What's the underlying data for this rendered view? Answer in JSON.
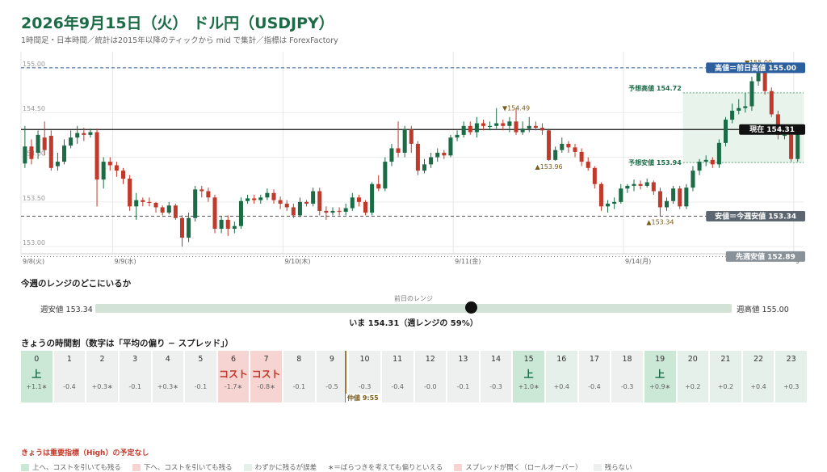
{
  "header": {
    "title": "2026年9月15日（火） ドル円（USDJPY）",
    "subtitle": "1時間足・日本時間／統計は2015年以降のティックから mid で集計／指標は ForexFactory"
  },
  "colors": {
    "up": "#1b6b46",
    "down": "#c0392b",
    "accent": "#1b6b46"
  },
  "chart_data": {
    "type": "candlestick",
    "ylim": [
      152.92,
      155.18
    ],
    "yticks": [
      "155.00",
      "154.50",
      "154.00",
      "153.50",
      "153.00"
    ],
    "ytick_values": [
      155.0,
      154.5,
      154.0,
      153.5,
      153.0
    ],
    "xticks": [
      {
        "label": "9/8(火)",
        "index": 0
      },
      {
        "label": "9/9(水)",
        "index": 14
      },
      {
        "label": "9/10(木)",
        "index": 40
      },
      {
        "label": "9/11(金)",
        "index": 66
      },
      {
        "label": "9/14(月)",
        "index": 92
      },
      {
        "label": "9",
        "index": 118
      }
    ],
    "candles": [
      [
        153.93,
        154.12,
        154.35,
        153.88
      ],
      [
        154.12,
        153.98,
        154.2,
        153.92
      ],
      [
        154.05,
        154.25,
        154.3,
        153.98
      ],
      [
        154.22,
        154.08,
        154.4,
        154.02
      ],
      [
        154.24,
        153.88,
        154.3,
        153.85
      ],
      [
        153.9,
        153.95,
        154.05,
        153.85
      ],
      [
        153.95,
        154.13,
        154.2,
        153.92
      ],
      [
        154.13,
        154.22,
        154.3,
        154.1
      ],
      [
        154.22,
        154.27,
        154.35,
        154.15
      ],
      [
        154.27,
        154.25,
        154.33,
        154.18
      ],
      [
        154.25,
        154.28,
        154.32,
        154.22
      ],
      [
        154.28,
        153.75,
        154.32,
        153.45
      ],
      [
        153.75,
        153.95,
        154.0,
        153.65
      ],
      [
        153.95,
        153.91,
        154.0,
        153.85
      ],
      [
        153.91,
        153.85,
        153.95,
        153.78
      ],
      [
        153.85,
        153.76,
        153.88,
        153.7
      ],
      [
        153.76,
        153.45,
        153.8,
        153.4
      ],
      [
        153.45,
        153.52,
        153.6,
        153.3
      ],
      [
        153.52,
        153.5,
        153.55,
        153.45
      ],
      [
        153.5,
        153.49,
        153.55,
        153.45
      ],
      [
        153.49,
        153.44,
        153.5,
        153.38
      ],
      [
        153.44,
        153.38,
        153.46,
        153.35
      ],
      [
        153.38,
        153.46,
        153.5,
        153.36
      ],
      [
        153.46,
        153.32,
        153.48,
        153.3
      ],
      [
        153.32,
        153.1,
        153.35,
        153.0
      ],
      [
        153.1,
        153.32,
        153.38,
        153.05
      ],
      [
        153.32,
        153.64,
        153.68,
        153.28
      ],
      [
        153.64,
        153.62,
        153.68,
        153.55
      ],
      [
        153.62,
        153.55,
        153.66,
        153.5
      ],
      [
        153.55,
        153.2,
        153.58,
        153.15
      ],
      [
        153.2,
        153.3,
        153.34,
        153.15
      ],
      [
        153.3,
        153.2,
        153.35,
        153.12
      ],
      [
        153.2,
        153.23,
        153.28,
        153.15
      ],
      [
        153.23,
        153.51,
        153.55,
        153.2
      ],
      [
        153.51,
        153.54,
        153.58,
        153.48
      ],
      [
        153.54,
        153.52,
        153.58,
        153.48
      ],
      [
        153.52,
        153.55,
        153.58,
        153.48
      ],
      [
        153.55,
        153.6,
        153.65,
        153.52
      ],
      [
        153.6,
        153.52,
        153.64,
        153.48
      ],
      [
        153.52,
        153.48,
        153.56,
        153.42
      ],
      [
        153.48,
        153.44,
        153.52,
        153.4
      ],
      [
        153.44,
        153.35,
        153.48,
        153.32
      ],
      [
        153.35,
        153.5,
        153.55,
        153.33
      ],
      [
        153.5,
        153.48,
        153.52,
        153.45
      ],
      [
        153.48,
        153.62,
        153.66,
        153.45
      ],
      [
        153.62,
        153.4,
        153.66,
        153.35
      ],
      [
        153.4,
        153.38,
        153.45,
        153.3
      ],
      [
        153.38,
        153.4,
        153.44,
        153.35
      ],
      [
        153.4,
        153.39,
        153.44,
        153.35
      ],
      [
        153.39,
        153.43,
        153.48,
        153.35
      ],
      [
        153.43,
        153.55,
        153.6,
        153.4
      ],
      [
        153.55,
        153.5,
        153.58,
        153.45
      ],
      [
        153.5,
        153.38,
        153.52,
        153.35
      ],
      [
        153.38,
        153.7,
        153.72,
        153.35
      ],
      [
        153.7,
        153.65,
        153.8,
        153.62
      ],
      [
        153.65,
        153.95,
        154.0,
        153.62
      ],
      [
        153.95,
        154.1,
        154.15,
        153.9
      ],
      [
        154.1,
        154.05,
        154.4,
        154.0
      ],
      [
        154.05,
        154.31,
        154.35,
        154.0
      ],
      [
        154.31,
        154.15,
        154.35,
        154.05
      ],
      [
        154.15,
        153.85,
        154.18,
        153.8
      ],
      [
        153.85,
        153.92,
        153.98,
        153.82
      ],
      [
        153.92,
        154.0,
        154.05,
        153.88
      ],
      [
        154.0,
        154.05,
        154.1,
        153.95
      ],
      [
        154.05,
        154.02,
        154.08,
        153.98
      ],
      [
        154.02,
        154.22,
        154.25,
        154.0
      ],
      [
        154.22,
        154.25,
        154.3,
        154.18
      ],
      [
        154.25,
        154.35,
        154.4,
        154.22
      ],
      [
        154.35,
        154.28,
        154.4,
        154.25
      ],
      [
        154.28,
        154.38,
        154.45,
        154.22
      ],
      [
        154.38,
        154.35,
        154.42,
        154.3
      ],
      [
        154.35,
        154.35,
        154.4,
        154.3
      ],
      [
        154.35,
        154.38,
        154.55,
        154.32
      ],
      [
        154.38,
        154.35,
        154.42,
        154.3
      ],
      [
        154.35,
        154.4,
        154.45,
        154.28
      ],
      [
        154.4,
        154.28,
        154.55,
        154.25
      ],
      [
        154.28,
        154.32,
        154.4,
        154.25
      ],
      [
        154.32,
        154.35,
        154.45,
        154.28
      ],
      [
        154.35,
        154.33,
        154.4,
        154.3
      ],
      [
        154.33,
        154.3,
        154.38,
        154.25
      ],
      [
        154.3,
        153.97,
        154.32,
        153.96
      ],
      [
        153.97,
        154.08,
        154.12,
        153.96
      ],
      [
        154.08,
        154.15,
        154.22,
        154.05
      ],
      [
        154.15,
        154.11,
        154.18,
        154.05
      ],
      [
        154.11,
        154.06,
        154.15,
        154.0
      ],
      [
        154.06,
        153.95,
        154.1,
        153.9
      ],
      [
        153.95,
        153.88,
        154.0,
        153.85
      ],
      [
        153.88,
        153.7,
        153.9,
        153.65
      ],
      [
        153.7,
        153.45,
        153.72,
        153.4
      ],
      [
        153.45,
        153.48,
        153.52,
        153.38
      ],
      [
        153.48,
        153.5,
        153.55,
        153.42
      ],
      [
        153.5,
        153.65,
        153.7,
        153.48
      ],
      [
        153.65,
        153.68,
        153.7,
        153.6
      ],
      [
        153.68,
        153.7,
        153.75,
        153.62
      ],
      [
        153.7,
        153.68,
        153.74,
        153.64
      ],
      [
        153.68,
        153.72,
        153.76,
        153.66
      ],
      [
        153.72,
        153.62,
        153.74,
        153.58
      ],
      [
        153.62,
        153.44,
        153.66,
        153.34
      ],
      [
        153.44,
        153.51,
        153.55,
        153.4
      ],
      [
        153.51,
        153.65,
        153.68,
        153.48
      ],
      [
        153.65,
        153.45,
        153.68,
        153.42
      ],
      [
        153.45,
        153.66,
        153.7,
        153.42
      ],
      [
        153.66,
        153.85,
        153.9,
        153.62
      ],
      [
        153.85,
        153.95,
        153.98,
        153.8
      ],
      [
        153.95,
        153.97,
        154.02,
        153.9
      ],
      [
        153.97,
        153.92,
        154.0,
        153.88
      ],
      [
        153.92,
        154.16,
        154.2,
        153.88
      ],
      [
        154.16,
        154.42,
        154.45,
        154.12
      ],
      [
        154.42,
        154.52,
        154.6,
        154.38
      ],
      [
        154.52,
        154.55,
        154.65,
        154.48
      ],
      [
        154.55,
        154.57,
        154.72,
        154.5
      ],
      [
        154.57,
        154.85,
        154.9,
        154.52
      ],
      [
        154.85,
        154.98,
        155.0,
        154.8
      ],
      [
        154.98,
        154.74,
        155.0,
        154.7
      ],
      [
        154.74,
        154.48,
        154.78,
        154.45
      ],
      [
        154.48,
        154.25,
        154.52,
        154.2
      ],
      [
        154.25,
        154.25,
        154.35,
        154.2
      ],
      [
        154.25,
        153.98,
        154.28,
        153.95
      ],
      [
        153.98,
        154.31,
        154.35,
        153.95
      ]
    ],
    "levels": [
      {
        "name": "高値＝前日高値 155.00",
        "value": 155.0,
        "style": "dashed",
        "color": "#2c5f9e",
        "label_bg": "#2c5f9e"
      },
      {
        "name": "安値＝今週安値 153.34",
        "value": 153.34,
        "style": "dashed",
        "color": "#555",
        "label_bg": "#5c6670"
      },
      {
        "name": "先週安値 152.89",
        "value": 152.89,
        "style": "dotted",
        "color": "#777",
        "label_bg": "#8a9299"
      },
      {
        "name": "現在 154.31",
        "value": 154.31,
        "style": "solid",
        "color": "#111",
        "label_bg": "#111"
      }
    ],
    "forecast": {
      "high_label": "予想高値 154.72",
      "high": 154.72,
      "low_label": "予想安値 153.94",
      "low": 153.94,
      "start_index": 101
    },
    "annotations": [
      {
        "text": "▼155.00",
        "index": 112,
        "price": 155.0,
        "pos": "above"
      },
      {
        "text": "▼154.49",
        "index": 75,
        "price": 154.49,
        "pos": "above"
      },
      {
        "text": "▲153.96",
        "index": 80,
        "price": 153.96,
        "pos": "below"
      },
      {
        "text": "▲153.34",
        "index": 97,
        "price": 153.34,
        "pos": "below"
      }
    ]
  },
  "week_range": {
    "title": "今週のレンジのどこにいるか",
    "low_label": "週安値 153.34",
    "high_label": "週高値 155.00",
    "current_label": "いま 154.31（週レンジの 59%）",
    "prev_day_label": "前日のレンジ",
    "position": 0.59
  },
  "hours": {
    "title": "きょうの時間割（数字は「平均の偏り − スプレッド」）",
    "marker_label": "仲値 9:55",
    "items": [
      {
        "h": "0",
        "mark": "上",
        "val": "+1.1∗",
        "type": "up"
      },
      {
        "h": "1",
        "mark": "",
        "val": "-0.4",
        "type": "none"
      },
      {
        "h": "2",
        "mark": "",
        "val": "+0.3∗",
        "type": "none"
      },
      {
        "h": "3",
        "mark": "",
        "val": "-0.1",
        "type": "none"
      },
      {
        "h": "4",
        "mark": "",
        "val": "+0.3∗",
        "type": "none"
      },
      {
        "h": "5",
        "mark": "",
        "val": "-0.1",
        "type": "none"
      },
      {
        "h": "6",
        "mark": "コスト",
        "val": "-1.7∗",
        "type": "cost"
      },
      {
        "h": "7",
        "mark": "コスト",
        "val": "-0.8∗",
        "type": "cost"
      },
      {
        "h": "8",
        "mark": "",
        "val": "-0.1",
        "type": "none"
      },
      {
        "h": "9",
        "mark": "",
        "val": "-0.5",
        "type": "none"
      },
      {
        "h": "10",
        "mark": "",
        "val": "-0.3",
        "type": "none"
      },
      {
        "h": "11",
        "mark": "",
        "val": "-0.4",
        "type": "none"
      },
      {
        "h": "12",
        "mark": "",
        "val": "-0.0",
        "type": "none"
      },
      {
        "h": "13",
        "mark": "",
        "val": "-0.1",
        "type": "none"
      },
      {
        "h": "14",
        "mark": "",
        "val": "-0.3",
        "type": "none"
      },
      {
        "h": "15",
        "mark": "上",
        "val": "+1.0∗",
        "type": "up"
      },
      {
        "h": "16",
        "mark": "",
        "val": "+0.4",
        "type": "slight"
      },
      {
        "h": "17",
        "mark": "",
        "val": "-0.4",
        "type": "none"
      },
      {
        "h": "18",
        "mark": "",
        "val": "-0.3",
        "type": "none"
      },
      {
        "h": "19",
        "mark": "上",
        "val": "+0.9∗",
        "type": "up"
      },
      {
        "h": "20",
        "mark": "",
        "val": "+0.2",
        "type": "slight"
      },
      {
        "h": "21",
        "mark": "",
        "val": "+0.2",
        "type": "slight"
      },
      {
        "h": "22",
        "mark": "",
        "val": "+0.4",
        "type": "slight"
      },
      {
        "h": "23",
        "mark": "",
        "val": "+0.3",
        "type": "slight"
      }
    ]
  },
  "notice": "きょうは重要指標（High）の予定なし",
  "legend": [
    {
      "text": "上へ、コストを引いても残る",
      "color": "#cbe8d6"
    },
    {
      "text": "下へ、コストを引いても残る",
      "color": "#f6d4d1"
    },
    {
      "text": "わずかに残るが誤差",
      "color": "#e4f0e9"
    },
    {
      "text": "∗＝ばらつきを考えても偏りといえる",
      "color": ""
    },
    {
      "text": "スプレッドが開く（ロールオーバー）",
      "color": "#f6d4d1"
    },
    {
      "text": "残らない",
      "color": "#eef0ef"
    }
  ]
}
